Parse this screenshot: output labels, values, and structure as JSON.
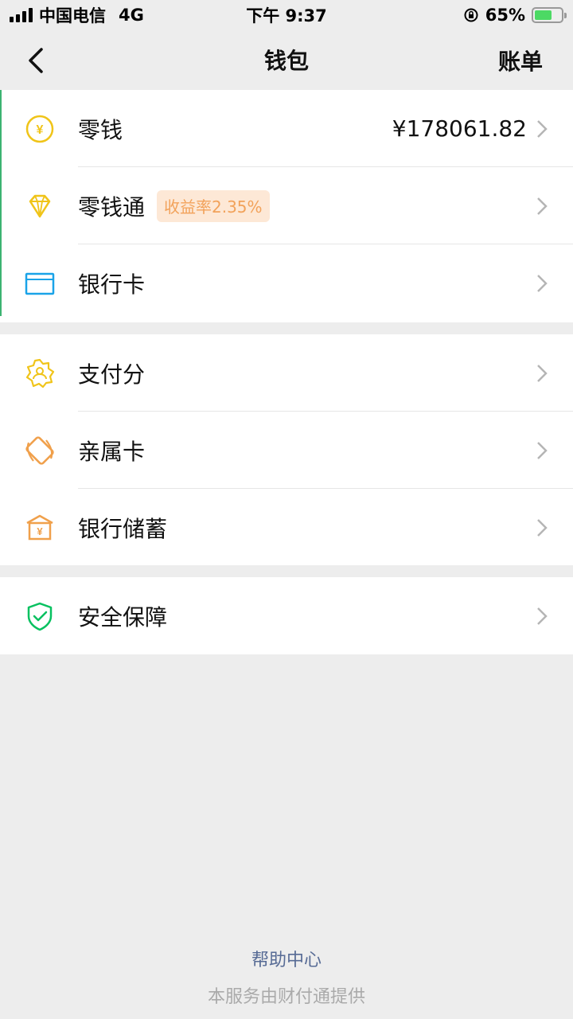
{
  "status_bar": {
    "carrier": "中国电信",
    "network": "4G",
    "time": "下午 9:37",
    "battery": "65%"
  },
  "nav": {
    "title": "钱包",
    "right_label": "账单"
  },
  "groups": [
    {
      "items": [
        {
          "label": "零钱",
          "value": "¥178061.82",
          "icon": "yuan-coin-icon"
        },
        {
          "label": "零钱通",
          "badge": "收益率2.35%",
          "icon": "diamond-icon"
        },
        {
          "label": "银行卡",
          "icon": "bank-card-icon"
        }
      ]
    },
    {
      "items": [
        {
          "label": "支付分",
          "icon": "pay-score-badge-icon"
        },
        {
          "label": "亲属卡",
          "icon": "family-card-icon"
        },
        {
          "label": "银行储蓄",
          "icon": "bank-savings-icon"
        }
      ]
    },
    {
      "items": [
        {
          "label": "安全保障",
          "icon": "security-shield-icon"
        }
      ]
    }
  ],
  "footer": {
    "help_label": "帮助中心",
    "provider_note": "本服务由财付通提供"
  },
  "colors": {
    "background": "#ededed",
    "accent_green": "#07c160",
    "icon_yellow": "#f0c419",
    "icon_blue": "#1aa3e8",
    "icon_orange": "#f0a04b",
    "badge_text": "#f2a25a",
    "link_blue": "#576b95"
  }
}
